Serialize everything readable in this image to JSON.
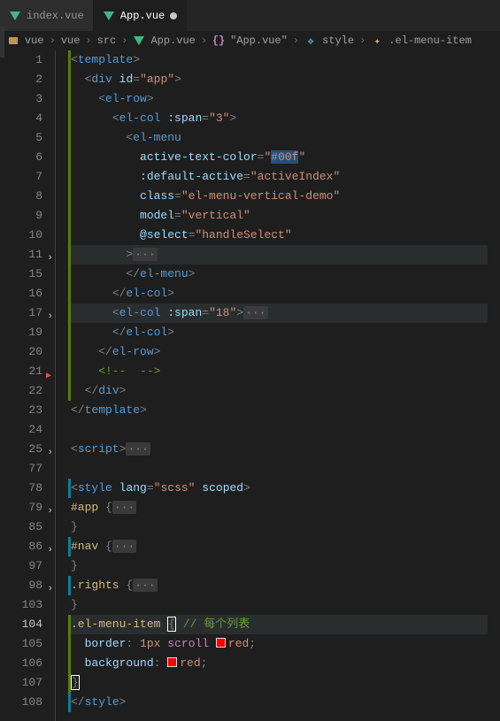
{
  "tabs": [
    {
      "label": "index.vue",
      "active": false,
      "dirty": false
    },
    {
      "label": "App.vue",
      "active": true,
      "dirty": true
    }
  ],
  "breadcrumbs": {
    "seg0": "vue",
    "seg1": "vue",
    "seg2": "src",
    "seg3": "App.vue",
    "seg4": "\"App.vue\"",
    "seg5": "style",
    "seg6": ".el-menu-item"
  },
  "lineNumbers": [
    "1",
    "2",
    "3",
    "4",
    "5",
    "6",
    "7",
    "8",
    "9",
    "10",
    "11",
    "15",
    "16",
    "17",
    "19",
    "20",
    "21",
    "22",
    "23",
    "24",
    "25",
    "77",
    "78",
    "79",
    "85",
    "86",
    "97",
    "98",
    "103",
    "104",
    "105",
    "106",
    "107",
    "108"
  ],
  "code": {
    "l1": {
      "indent": 0
    },
    "l2": {
      "indent": 1,
      "attr": "id",
      "val": "\"app\""
    },
    "l3": {
      "indent": 2,
      "tag": "el-row"
    },
    "l4": {
      "indent": 3,
      "tag": "el-col",
      "attr": ":span",
      "val": "\"3\""
    },
    "l5": {
      "indent": 4,
      "tag": "el-menu"
    },
    "l6": {
      "indent": 5,
      "attr": "active-text-color",
      "val": "\"",
      "hex": "#00f",
      "valEnd": "\""
    },
    "l7": {
      "indent": 5,
      "attr": ":default-active",
      "val": "\"activeIndex\""
    },
    "l8": {
      "indent": 5,
      "attr": "class",
      "val": "\"el-menu-vertical-demo\""
    },
    "l9": {
      "indent": 5,
      "attr": "model",
      "val": "\"vertical\""
    },
    "l10": {
      "indent": 5,
      "attr": "@select",
      "val": "\"handleSelect\""
    },
    "l11": {
      "indent": 4,
      "text": ">"
    },
    "l15": {
      "indent": 4,
      "tag": "el-menu"
    },
    "l16": {
      "indent": 3,
      "tag": "el-col"
    },
    "l17": {
      "indent": 3,
      "tag": "el-col",
      "attr": ":span",
      "val": "\"18\""
    },
    "l19": {
      "indent": 3,
      "tag": "el-col"
    },
    "l20": {
      "indent": 2,
      "tag": "el-row"
    },
    "l21": {
      "indent": 2,
      "comment": "<!--  -->"
    },
    "l22": {
      "indent": 1,
      "tag": "div"
    },
    "l23": {
      "indent": 0,
      "tag": "template"
    },
    "l25": {
      "indent": 0,
      "tag": "script"
    },
    "l78": {
      "indent": 0,
      "tag": "style",
      "attr1": "lang",
      "val1": "\"scss\"",
      "attr2": "scoped"
    },
    "l79": {
      "indent": 0,
      "sel": "#app"
    },
    "l85": {
      "indent": 0,
      "brace": "}"
    },
    "l86": {
      "indent": 0,
      "sel": "#nav"
    },
    "l97": {
      "indent": 0,
      "brace": "}"
    },
    "l98": {
      "indent": 0,
      "sel": ".rights"
    },
    "l103": {
      "indent": 0,
      "brace": "}"
    },
    "l104": {
      "indent": 0,
      "sel": ".el-menu-item",
      "comment": "// 每个列表"
    },
    "l105": {
      "indent": 1,
      "prop": "border",
      "val": "1px",
      "kw": "scroll",
      "color": "red",
      "swatch": "#ff0000"
    },
    "l106": {
      "indent": 1,
      "prop": "background",
      "color": "red",
      "swatch": "#ff0000"
    },
    "l107": {
      "indent": 0,
      "brace": "}"
    },
    "l108": {
      "indent": 0,
      "tag": "style"
    }
  },
  "ellipsis": "···",
  "chart_data": null
}
